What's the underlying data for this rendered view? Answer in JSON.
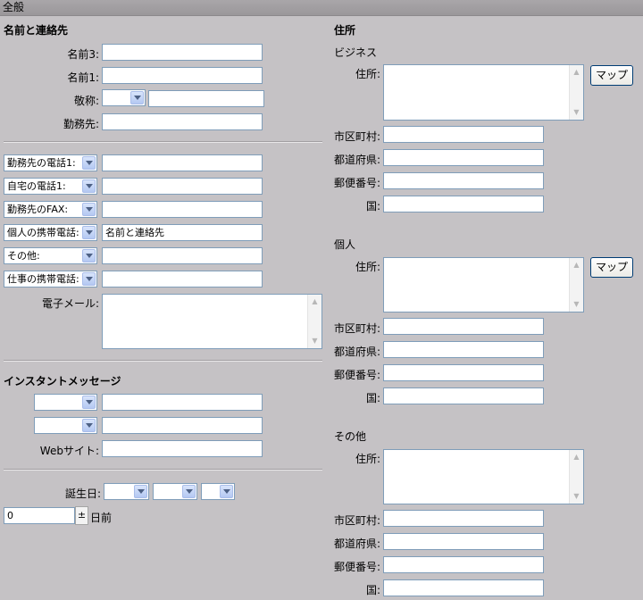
{
  "title": "全般",
  "contact": {
    "heading": "名前と連絡先",
    "name3_label": "名前3:",
    "name1_label": "名前1:",
    "title_label": "敬称:",
    "company_label": "勤務先:"
  },
  "phones": {
    "rows": [
      {
        "type": "勤務先の電話1:",
        "value": ""
      },
      {
        "type": "自宅の電話1:",
        "value": ""
      },
      {
        "type": "勤務先のFAX:",
        "value": ""
      },
      {
        "type": "個人の携帯電話:",
        "value": "名前と連絡先"
      },
      {
        "type": "その他:",
        "value": ""
      },
      {
        "type": "仕事の携帯電話:",
        "value": ""
      }
    ],
    "email_label": "電子メール:"
  },
  "im": {
    "heading": "インスタントメッセージ",
    "website_label": "Webサイト:"
  },
  "birthday": {
    "label": "誕生日:",
    "days_value": "0",
    "spin_glyph": "±",
    "days_suffix": "日前"
  },
  "address": {
    "heading": "住所",
    "sections": [
      {
        "title": "ビジネス",
        "address_label": "住所:",
        "map_button": "マップ",
        "city_label": "市区町村:",
        "state_label": "都道府県:",
        "zip_label": "郵便番号:",
        "country_label": "国:"
      },
      {
        "title": "個人",
        "address_label": "住所:",
        "map_button": "マップ",
        "city_label": "市区町村:",
        "state_label": "都道府県:",
        "zip_label": "郵便番号:",
        "country_label": "国:"
      },
      {
        "title": "その他",
        "address_label": "住所:",
        "city_label": "市区町村:",
        "state_label": "都道府県:",
        "zip_label": "郵便番号:",
        "country_label": "国:"
      }
    ]
  }
}
